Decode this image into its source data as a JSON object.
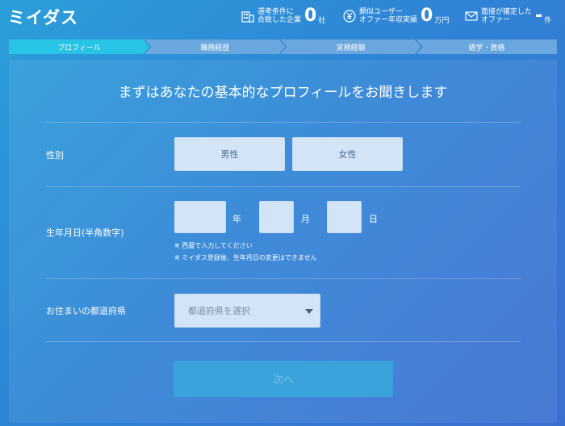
{
  "header": {
    "logo": "ミイダス",
    "stats": [
      {
        "icon": "building-icon",
        "label_line1": "選考条件に",
        "label_line2": "合致した企業",
        "value": "0",
        "unit": "社"
      },
      {
        "icon": "yen-icon",
        "label_line1": "類似ユーザー",
        "label_line2": "オファー年収実績",
        "value": "0",
        "unit": "万円"
      },
      {
        "icon": "mail-icon",
        "label_line1": "面接が確定した",
        "label_line2": "オファー",
        "value": "-",
        "unit": "件"
      }
    ]
  },
  "steps": [
    {
      "label": "プロフィール",
      "active": true
    },
    {
      "label": "職務経歴",
      "active": false
    },
    {
      "label": "実務経験",
      "active": false
    },
    {
      "label": "語学・資格",
      "active": false
    }
  ],
  "form": {
    "title": "まずはあなたの基本的なプロフィールをお聞きします",
    "gender": {
      "label": "性別",
      "options": [
        "男性",
        "女性"
      ]
    },
    "birthdate": {
      "label": "生年月日(半角数字)",
      "year_unit": "年",
      "month_unit": "月",
      "day_unit": "日",
      "note1": "※ 西暦で入力してください",
      "note2": "※ ミイダス登録後、生年月日の変更はできません"
    },
    "prefecture": {
      "label": "お住まいの都道府県",
      "placeholder": "都道府県を選択"
    },
    "next_label": "次へ"
  },
  "colors": {
    "accent": "#27c4e6",
    "input_bg": "#d4e4f7",
    "step_inactive": "#6aa7de"
  }
}
